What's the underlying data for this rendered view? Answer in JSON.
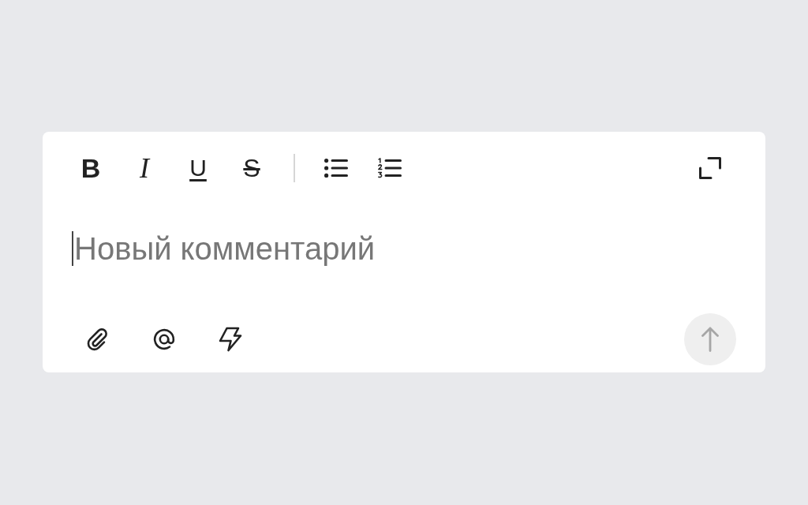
{
  "toolbar": {
    "format_buttons": [
      {
        "kind": "bold",
        "label": "B"
      },
      {
        "kind": "italic",
        "label": "I"
      },
      {
        "kind": "underline",
        "label": "U"
      },
      {
        "kind": "strikethrough",
        "label": "S"
      }
    ]
  },
  "editor": {
    "placeholder": "Новый комментарий",
    "focused": true
  },
  "send_button": {
    "disabled": true
  }
}
